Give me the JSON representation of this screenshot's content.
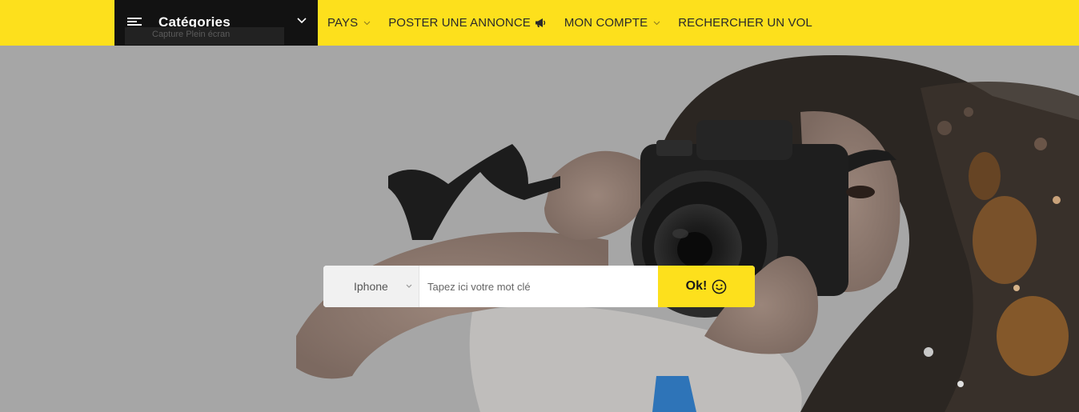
{
  "categories": {
    "label": "Catégories",
    "tooltip": "Capture Plein écran"
  },
  "nav": {
    "items": [
      {
        "label": "PAYS",
        "has_dropdown": true
      },
      {
        "label": "POSTER UNE ANNONCE",
        "icon": "megaphone-icon"
      },
      {
        "label": "MON COMPTE",
        "has_dropdown": true
      },
      {
        "label": "RECHERCHER UN VOL"
      }
    ]
  },
  "search": {
    "category_selected": "Iphone",
    "placeholder": "Tapez ici votre mot clé",
    "button_label": "Ok!",
    "button_icon": "smiley-icon"
  },
  "colors": {
    "brand_yellow": "#fde01c",
    "dark": "#121212",
    "hero_gray": "#a6a6a6"
  }
}
